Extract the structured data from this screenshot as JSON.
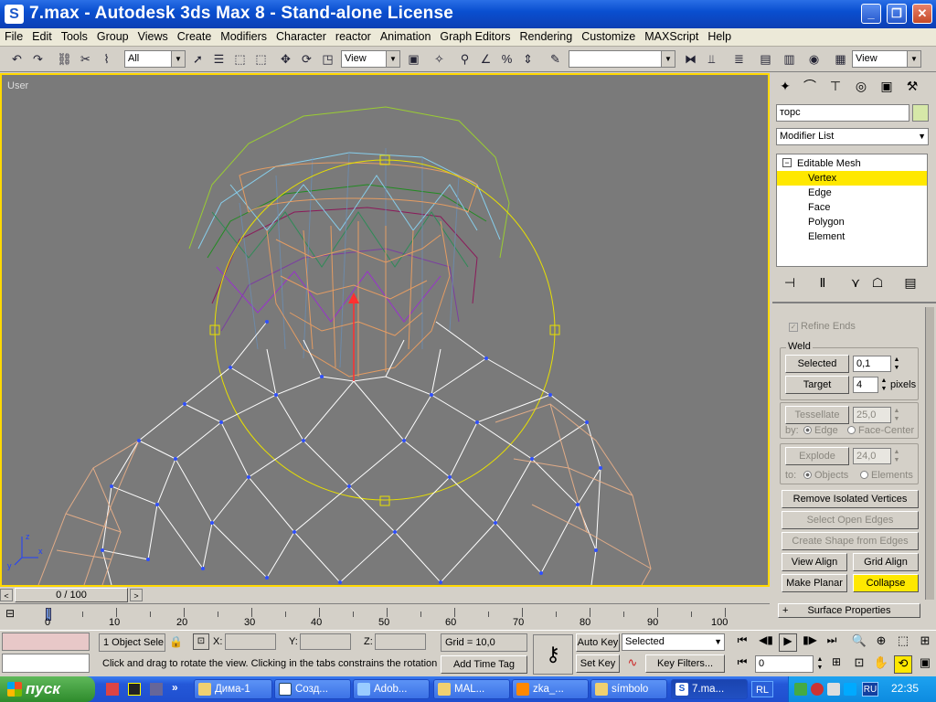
{
  "window": {
    "title": "7.max - Autodesk 3ds Max 8  - Stand-alone License"
  },
  "menu": [
    "File",
    "Edit",
    "Tools",
    "Group",
    "Views",
    "Create",
    "Modifiers",
    "Character",
    "reactor",
    "Animation",
    "Graph Editors",
    "Rendering",
    "Customize",
    "MAXScript",
    "Help"
  ],
  "toolbar": {
    "selection_filter": "All",
    "ref_coord": "View",
    "named_sel": "",
    "view_dropdown": "View"
  },
  "viewport": {
    "label": "User"
  },
  "command_panel": {
    "object_name": "торс",
    "object_color": "#d6e8a8",
    "modifier_list": "Modifier List",
    "stack": [
      "Editable Mesh",
      "Vertex",
      "Edge",
      "Face",
      "Polygon",
      "Element"
    ],
    "selected_subobject": "Vertex",
    "refine_ends": "Refine Ends",
    "weld": {
      "title": "Weld",
      "selected_label": "Selected",
      "selected_value": "0,1",
      "target_label": "Target",
      "target_value": "4",
      "pixels_label": "pixels"
    },
    "tessellate": {
      "label": "Tessellate",
      "value": "25,0",
      "by_label": "by:",
      "opt1": "Edge",
      "opt2": "Face-Center"
    },
    "explode": {
      "label": "Explode",
      "value": "24,0",
      "to_label": "to:",
      "opt1": "Objects",
      "opt2": "Elements"
    },
    "buttons": {
      "remove_isolated": "Remove Isolated Vertices",
      "select_open_edges": "Select Open Edges",
      "create_shape": "Create Shape from Edges",
      "view_align": "View Align",
      "grid_align": "Grid Align",
      "make_planar": "Make Planar",
      "collapse": "Collapse"
    },
    "surface_properties": "Surface Properties"
  },
  "timeline": {
    "frame_display": "0 / 100",
    "ticks": [
      "0",
      "10",
      "20",
      "30",
      "40",
      "50",
      "60",
      "70",
      "80",
      "90",
      "100"
    ]
  },
  "status": {
    "selection": "1 Object Sele",
    "x_label": "X:",
    "y_label": "Y:",
    "z_label": "Z:",
    "grid": "Grid = 10,0",
    "prompt": "Click and drag to rotate the view.  Clicking in the tabs constrains the rotation",
    "add_time_tag": "Add Time Tag",
    "auto_key": "Auto Key",
    "set_key": "Set Key",
    "key_mode": "Selected",
    "key_filters": "Key Filters...",
    "frame": "0"
  },
  "taskbar": {
    "start": "пуск",
    "tasks": [
      "Дима-1",
      "Созд...",
      "Adob...",
      "MAL...",
      "zka_...",
      "símbolo",
      "7.ma..."
    ],
    "lang": "RU",
    "clock": "22:35"
  }
}
